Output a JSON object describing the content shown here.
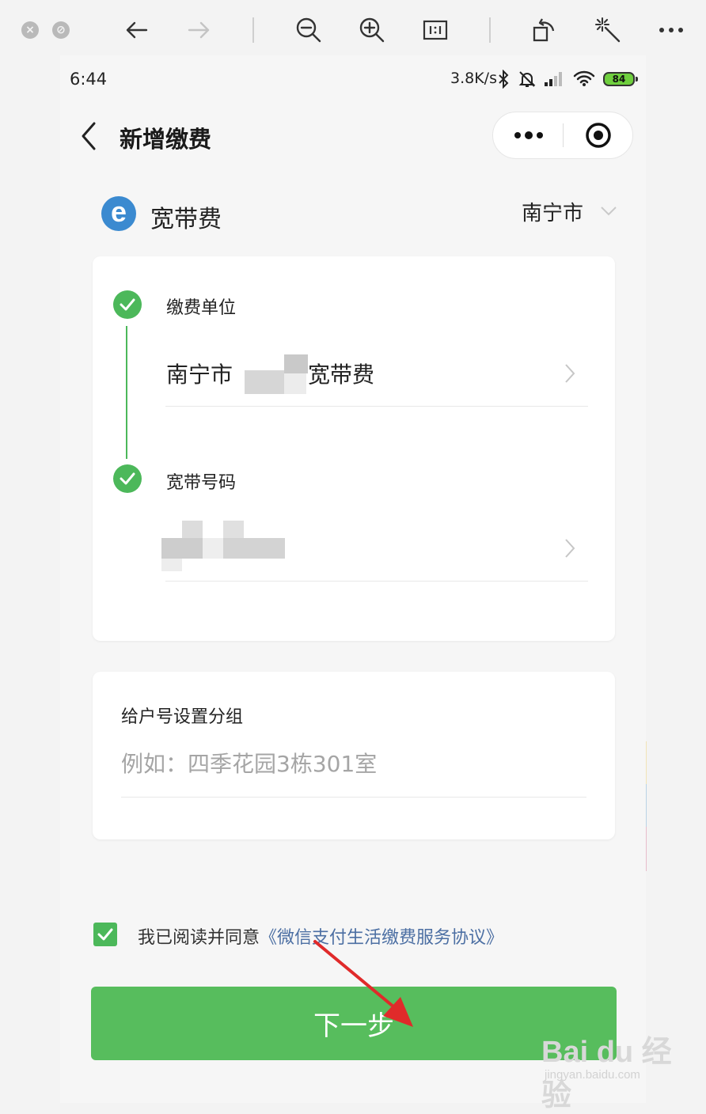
{
  "viewer": {
    "close_icon": "close-icon",
    "minimize_icon": "minimize-icon",
    "tools": [
      "back-arrow-icon",
      "forward-arrow-icon",
      "zoom-out-icon",
      "zoom-in-icon",
      "actual-size-icon",
      "rotate-icon",
      "magic-wand-icon",
      "more-icon"
    ]
  },
  "status_bar": {
    "time": "6:44",
    "speed": "3.8K/s",
    "battery": "84"
  },
  "nav": {
    "title": "新增缴费"
  },
  "service": {
    "name": "宽带费",
    "city": "南宁市",
    "icon_letter": "e"
  },
  "form": {
    "unit_label": "缴费单位",
    "unit_value_prefix": "南宁市",
    "unit_value_suffix": "宽带费",
    "number_label": "宽带号码"
  },
  "group": {
    "title": "给户号设置分组",
    "placeholder": "例如：四季花园3栋301室"
  },
  "agreement": {
    "prefix": "我已阅读并同意",
    "link": "《微信支付生活缴费服务协议》"
  },
  "next_button": "下一步",
  "watermark": {
    "logo": "Bai du 经验",
    "url": "jingyan.baidu.com"
  },
  "colors": {
    "primary_green": "#57bd5d",
    "link_blue": "#4c6fa3"
  }
}
